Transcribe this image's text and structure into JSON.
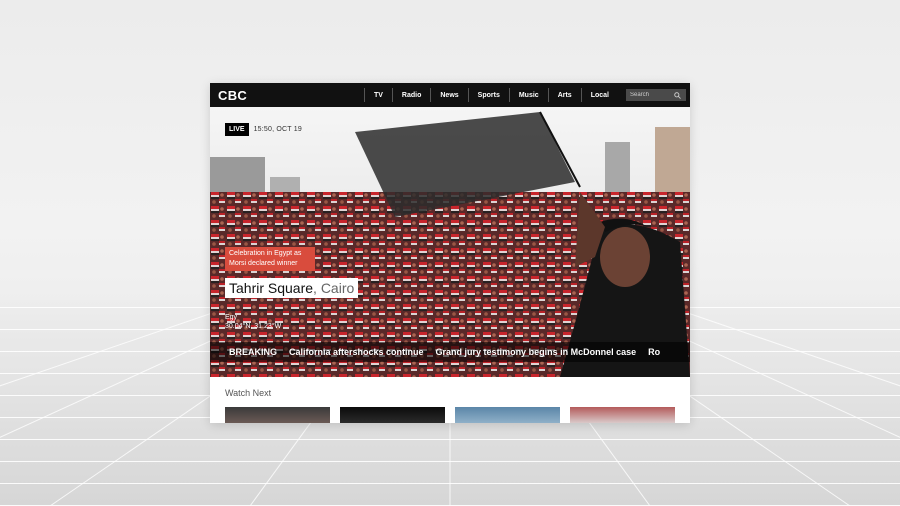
{
  "header": {
    "logo": "CBC",
    "nav": [
      "TV",
      "Radio",
      "News",
      "Sports",
      "Music",
      "Arts",
      "Local"
    ],
    "search_placeholder": "Search"
  },
  "hero": {
    "live_label": "LIVE",
    "timestamp": "15:50, OCT 19",
    "caption": "Celebration in Egypt as Morsi declared winner",
    "place": "Tahrir Square",
    "city": ", Cairo",
    "coords_line1": "Egy",
    "coords_line2": "30.04°N, 31.23°W"
  },
  "ticker": {
    "label": "BREAKING",
    "items": [
      "California aftershocks continue",
      "Grand jury testimony begins in McDonnel case",
      "Ro"
    ]
  },
  "watch_next": {
    "title": "Watch Next"
  }
}
